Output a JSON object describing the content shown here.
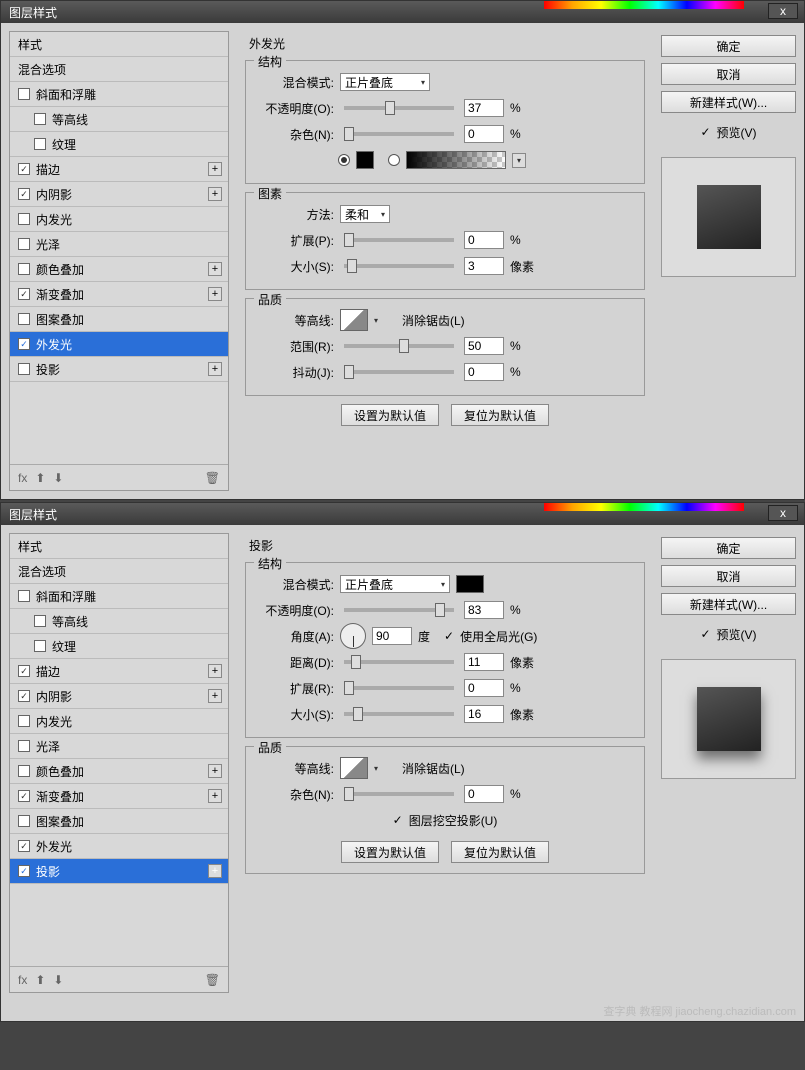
{
  "dialog_title": "图层样式",
  "close": "x",
  "left_panel": {
    "header": "样式",
    "blend_options": "混合选项",
    "items": [
      {
        "label": "斜面和浮雕",
        "checked": false,
        "plus": false
      },
      {
        "label": "等高线",
        "checked": false,
        "plus": false
      },
      {
        "label": "纹理",
        "checked": false,
        "plus": false
      },
      {
        "label": "描边",
        "checked": true,
        "plus": true
      },
      {
        "label": "内阴影",
        "checked": true,
        "plus": true
      },
      {
        "label": "内发光",
        "checked": false,
        "plus": false
      },
      {
        "label": "光泽",
        "checked": false,
        "plus": false
      },
      {
        "label": "颜色叠加",
        "checked": false,
        "plus": true
      },
      {
        "label": "渐变叠加",
        "checked": true,
        "plus": true
      },
      {
        "label": "图案叠加",
        "checked": false,
        "plus": false
      },
      {
        "label": "外发光",
        "checked": true,
        "plus": false
      },
      {
        "label": "投影",
        "checked": false,
        "plus": true
      }
    ],
    "fx": "fx"
  },
  "right_panel": {
    "ok": "确定",
    "cancel": "取消",
    "new_style": "新建样式(W)...",
    "preview": "预览(V)"
  },
  "panel1": {
    "title": "外发光",
    "structure": "结构",
    "blend_mode_lbl": "混合模式:",
    "blend_mode_val": "正片叠底",
    "opacity_lbl": "不透明度(O):",
    "opacity_val": "37",
    "pct": "%",
    "noise_lbl": "杂色(N):",
    "noise_val": "0",
    "elements": "图素",
    "method_lbl": "方法:",
    "method_val": "柔和",
    "spread_lbl": "扩展(P):",
    "spread_val": "0",
    "size_lbl": "大小(S):",
    "size_val": "3",
    "px": "像素",
    "quality": "品质",
    "contour_lbl": "等高线:",
    "antialias": "消除锯齿(L)",
    "range_lbl": "范围(R):",
    "range_val": "50",
    "jitter_lbl": "抖动(J):",
    "jitter_val": "0",
    "set_default": "设置为默认值",
    "reset_default": "复位为默认值"
  },
  "panel2": {
    "title": "投影",
    "structure": "结构",
    "blend_mode_lbl": "混合模式:",
    "blend_mode_val": "正片叠底",
    "opacity_lbl": "不透明度(O):",
    "opacity_val": "83",
    "pct": "%",
    "angle_lbl": "角度(A):",
    "angle_val": "90",
    "deg": "度",
    "global_light": "使用全局光(G)",
    "distance_lbl": "距离(D):",
    "distance_val": "11",
    "px": "像素",
    "spread_lbl": "扩展(R):",
    "spread_val": "0",
    "size_lbl": "大小(S):",
    "size_val": "16",
    "quality": "品质",
    "contour_lbl": "等高线:",
    "antialias": "消除锯齿(L)",
    "noise_lbl": "杂色(N):",
    "noise_val": "0",
    "knockout": "图层挖空投影(U)",
    "set_default": "设置为默认值",
    "reset_default": "复位为默认值",
    "selected_item": 11
  },
  "watermark": "查字典 教程网  jiaocheng.chazidian.com"
}
